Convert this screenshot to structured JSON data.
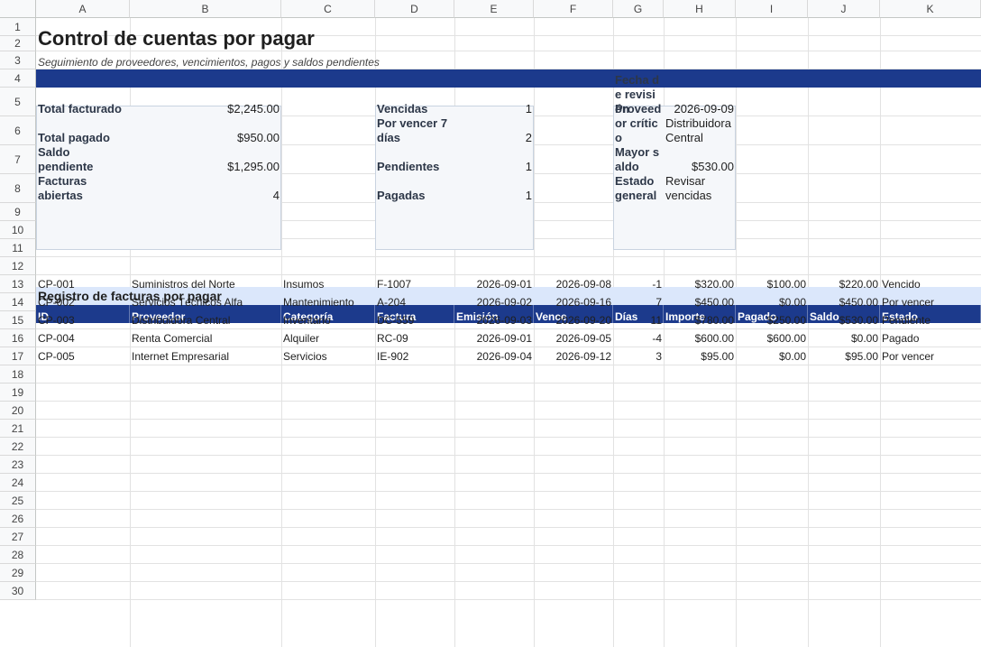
{
  "columns": [
    "A",
    "B",
    "C",
    "D",
    "E",
    "F",
    "G",
    "H",
    "I",
    "J",
    "K"
  ],
  "rows": [
    "1",
    "2",
    "3",
    "4",
    "5",
    "6",
    "7",
    "8",
    "9",
    "10",
    "11",
    "12",
    "13",
    "14",
    "15",
    "16",
    "17",
    "18",
    "19",
    "20",
    "21",
    "22",
    "23",
    "24",
    "25",
    "26",
    "27",
    "28",
    "29",
    "30"
  ],
  "title": "Control de cuentas por pagar",
  "subtitle": "Seguimiento de proveedores, vencimientos, pagos y saldos pendientes",
  "card1": [
    {
      "label": "Total facturado",
      "value": "$2,245.00"
    },
    {
      "label": "Total pagado",
      "value": "$950.00"
    },
    {
      "label": "Saldo pendiente",
      "value": "$1,295.00"
    },
    {
      "label": "Facturas abiertas",
      "value": "4"
    }
  ],
  "card2": [
    {
      "label": "Vencidas",
      "value": "1"
    },
    {
      "label": "Por vencer 7 días",
      "value": "2"
    },
    {
      "label": "Pendientes",
      "value": "1"
    },
    {
      "label": "Pagadas",
      "value": "1"
    }
  ],
  "card3": [
    {
      "label": "Fecha de revisión",
      "value": "2026-09-09"
    },
    {
      "label": "Proveedor crítico",
      "value": "Distribuidora Central"
    },
    {
      "label": "Mayor saldo",
      "value": "$530.00"
    },
    {
      "label": "Estado general",
      "value": "Revisar vencidas"
    }
  ],
  "section_title": "Registro de facturas por pagar",
  "headers": [
    "ID",
    "Proveedor",
    "Categoría",
    "Factura",
    "Emisión",
    "Vence",
    "Días",
    "Importe",
    "Pagado",
    "Saldo",
    "Estado"
  ],
  "records": [
    [
      "CP-001",
      "Suministros del Norte",
      "Insumos",
      "F-1007",
      "2026-09-01",
      "2026-09-08",
      "-1",
      "$320.00",
      "$100.00",
      "$220.00",
      "Vencido"
    ],
    [
      "CP-002",
      "Servicios Técnicos Alfa",
      "Mantenimiento",
      "A-204",
      "2026-09-02",
      "2026-09-16",
      "7",
      "$450.00",
      "$0.00",
      "$450.00",
      "Por vencer"
    ],
    [
      "CP-003",
      "Distribuidora Central",
      "Inventario",
      "DC-559",
      "2026-09-03",
      "2026-09-20",
      "11",
      "$780.00",
      "$250.00",
      "$530.00",
      "Pendiente"
    ],
    [
      "CP-004",
      "Renta Comercial",
      "Alquiler",
      "RC-09",
      "2026-09-01",
      "2026-09-05",
      "-4",
      "$600.00",
      "$600.00",
      "$0.00",
      "Pagado"
    ],
    [
      "CP-005",
      "Internet Empresarial",
      "Servicios",
      "IE-902",
      "2026-09-04",
      "2026-09-12",
      "3",
      "$95.00",
      "$0.00",
      "$95.00",
      "Por vencer"
    ]
  ]
}
